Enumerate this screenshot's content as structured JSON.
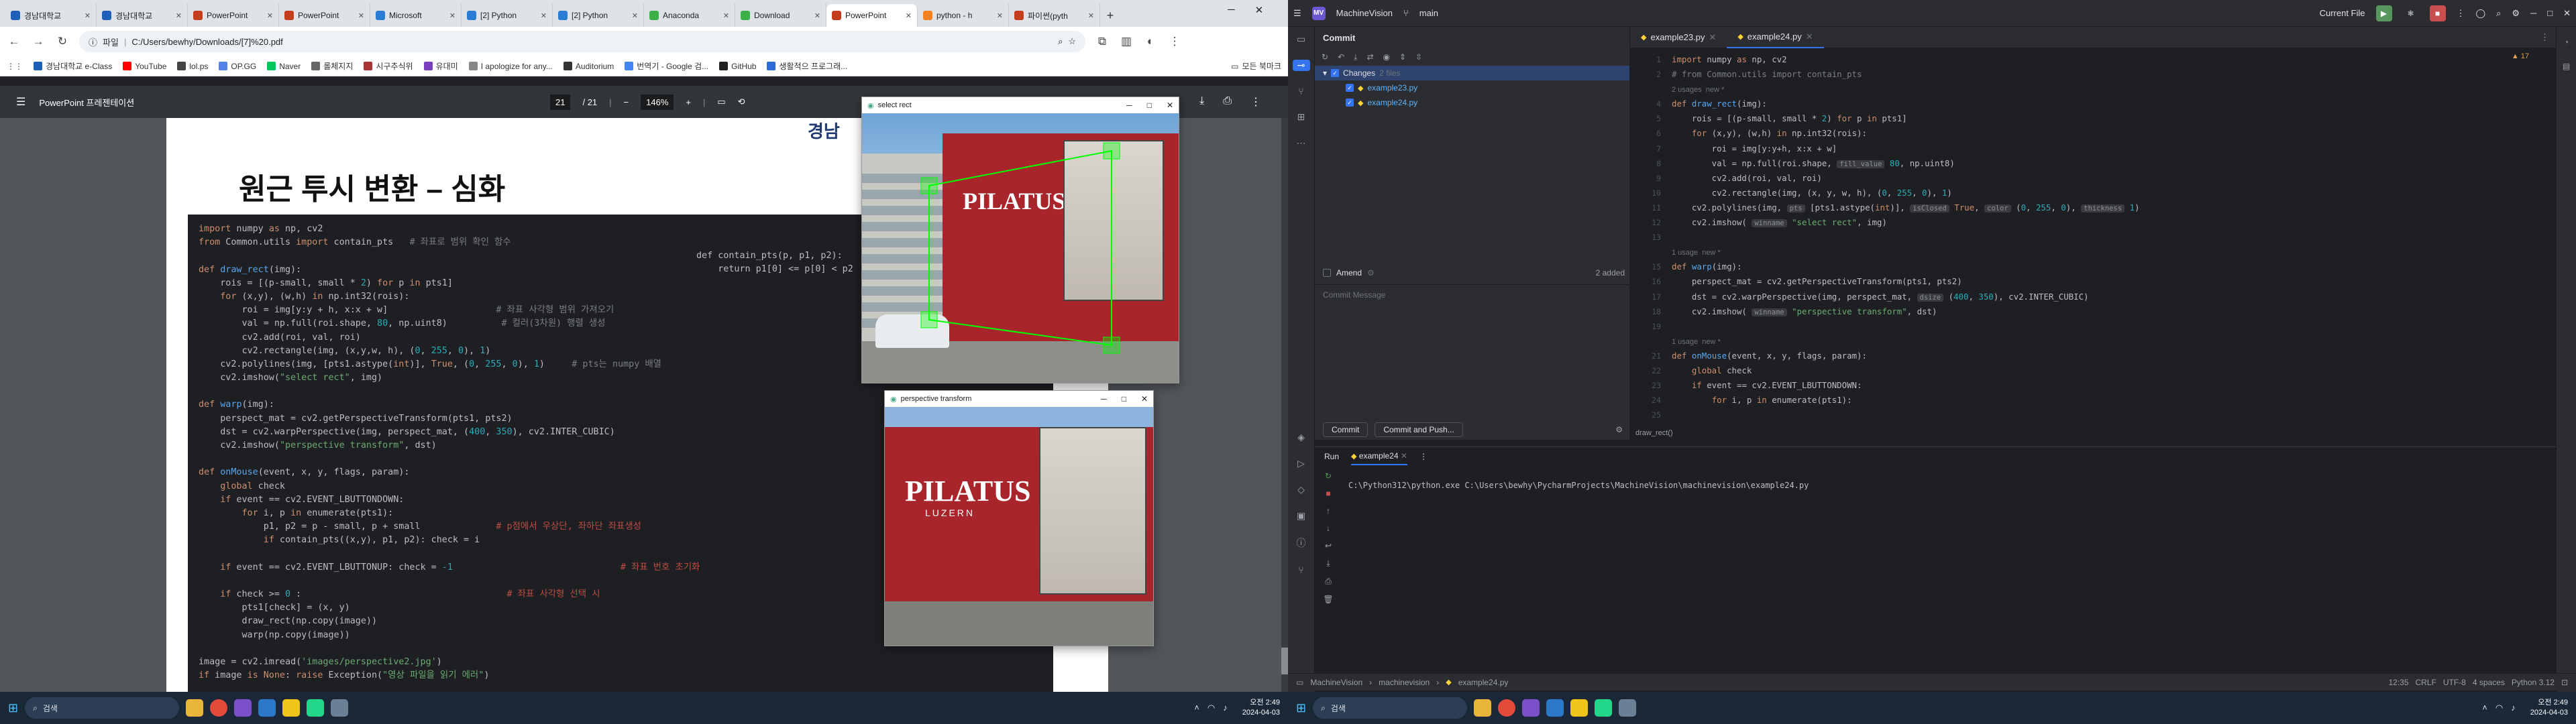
{
  "chrome": {
    "tabs": [
      {
        "title": "경남대학교",
        "color": "#1f5fb7"
      },
      {
        "title": "경남대학교",
        "color": "#1f5fb7"
      },
      {
        "title": "PowerPoint",
        "color": "#c43e1c"
      },
      {
        "title": "PowerPoint",
        "color": "#c43e1c"
      },
      {
        "title": "Microsoft",
        "color": "#2b7cd3"
      },
      {
        "title": "[2] Python",
        "color": "#2b7cd3"
      },
      {
        "title": "[2] Python",
        "color": "#2b7cd3"
      },
      {
        "title": "Anaconda",
        "color": "#3eb049"
      },
      {
        "title": "Download",
        "color": "#3eb049"
      },
      {
        "title": "PowerPoint",
        "color": "#c43e1c"
      },
      {
        "title": "python - h",
        "color": "#f48024"
      },
      {
        "title": "파이썬(pyth",
        "color": "#c43e1c"
      }
    ],
    "new_tab": "+",
    "url_label": "파일",
    "url": "C:/Users/bewhy/Downloads/[7]%20.pdf",
    "bookmarks": [
      {
        "label": "경남대학교 e-Class",
        "color": "#1f5fb7"
      },
      {
        "label": "YouTube",
        "color": "#ff0000"
      },
      {
        "label": "lol.ps",
        "color": "#444444"
      },
      {
        "label": "OP.GG",
        "color": "#5383e8"
      },
      {
        "label": "Naver",
        "color": "#03c75a"
      },
      {
        "label": "롤체지지",
        "color": "#666666"
      },
      {
        "label": "시구추식위",
        "color": "#a33"
      },
      {
        "label": "유대미",
        "color": "#7a3fbf"
      },
      {
        "label": "I apologize for any...",
        "color": "#888888"
      },
      {
        "label": "Auditorium",
        "color": "#333333"
      },
      {
        "label": "번역기 - Google 검...",
        "color": "#4285f4"
      },
      {
        "label": "GitHub",
        "color": "#222222"
      },
      {
        "label": "생활적으 프로그래...",
        "color": "#2d6bd6"
      }
    ],
    "bookmarks_all": "모든 북마크"
  },
  "pdf": {
    "title": "PowerPoint 프레젠테이션",
    "page_current": "21",
    "page_total": "/ 21",
    "zoom": "146%",
    "slide_title": "원근 투시 변환 – 심화",
    "logo_text": "경남",
    "code_right": [
      "def contain_pts(p, p1, p2):",
      "    return p1[0] <= p[0] < p2"
    ]
  },
  "cv_windows": {
    "select": {
      "title": "select rect"
    },
    "perspective": {
      "title": "perspective transform"
    },
    "sign_text": "PILATUS",
    "sign_sub": "LUZERN"
  },
  "ide": {
    "project": "MachineVision",
    "project_badge": "MV",
    "branch": "main",
    "run_config": "Current File",
    "commit_title": "Commit",
    "changes_label": "Changes",
    "changes_count": "2 files",
    "files": [
      "example23.py",
      "example24.py"
    ],
    "amend": "Amend",
    "added": "2 added",
    "commit_msg_placeholder": "Commit Message",
    "commit_btn": "Commit",
    "commit_push_btn": "Commit and Push...",
    "tabs": [
      "example23.py",
      "example24.py"
    ],
    "warnings": "▲ 17",
    "breadcrumb": "draw_rect()",
    "run_tab": "Run",
    "run_config_tab": "example24",
    "run_output": "C:\\Python312\\python.exe C:\\Users\\bewhy\\PycharmProjects\\MachineVision\\machinevision\\example24.py",
    "status": {
      "path": [
        "MachineVision",
        "machinevision",
        "example24.py"
      ],
      "pos": "12:35",
      "eol": "CRLF",
      "enc": "UTF-8",
      "indent": "4 spaces",
      "python": "Python 3.12"
    }
  },
  "taskbar": {
    "search": "검색",
    "time": "오전 2:49",
    "date": "2024-04-03"
  }
}
